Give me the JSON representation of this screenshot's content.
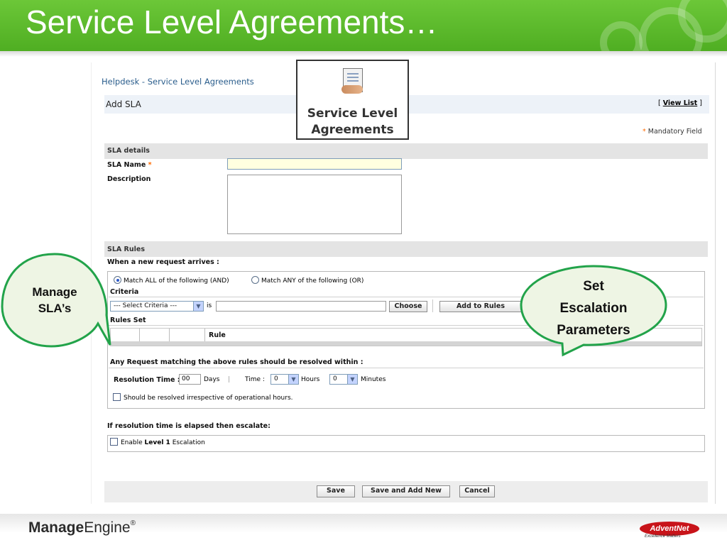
{
  "slide": {
    "title": "Service Level Agreements…",
    "brand_bold": "Manage",
    "brand_light": "Engine",
    "brand_reg": "®",
    "partner_logo": "AdventNet",
    "partner_tagline": "Excellence Matters"
  },
  "badge": {
    "line1": "Service Level",
    "line2": "Agreements",
    "icon": "handshake-document-icon"
  },
  "callouts": {
    "left": [
      "Manage",
      "SLA’s"
    ],
    "right": [
      "Set",
      "Escalation",
      "Parameters"
    ]
  },
  "app": {
    "breadcrumb": "Helpdesk - Service Level Agreements",
    "form_title": "Add SLA",
    "view_list": "View List",
    "mandatory_field": "Mandatory Field",
    "sla_details": {
      "section_title": "SLA details",
      "name_label": "SLA Name",
      "name_value": "",
      "description_label": "Description",
      "description_value": ""
    },
    "sla_rules": {
      "section_title": "SLA Rules",
      "when_label": "When a new request arrives :",
      "match_all": "Match ALL of the following (AND)",
      "match_any": "Match ANY of the following (OR)",
      "match_selected": "all",
      "criteria_label": "Criteria",
      "criteria_select": "--- Select Criteria ---",
      "is_label": "is",
      "criteria_value": "",
      "choose_button": "Choose",
      "add_to_rules_button": "Add to Rules",
      "rules_set_label": "Rules Set",
      "rule_column": "Rule",
      "resolve_within": "Any Request matching the above rules should be resolved within :",
      "resolution_time_label": "Resolution Time :",
      "days_value": "00",
      "days_label": "Days",
      "separator": "|",
      "time_label": "Time :",
      "hours_value": "0",
      "hours_label": "Hours",
      "minutes_value": "0",
      "minutes_label": "Minutes",
      "operational_hours": "Should be resolved irrespective of operational hours."
    },
    "escalation": {
      "label": "If resolution time is elapsed then escalate:",
      "enable_prefix": "Enable ",
      "enable_level": "Level 1",
      "enable_suffix": " Escalation"
    },
    "buttons": {
      "save": "Save",
      "save_and_add_new": "Save and Add New",
      "cancel": "Cancel"
    },
    "colors": {
      "header_green": "#5bb82b",
      "callout_border": "#22a34a",
      "input_highlight": "#ffffe0",
      "mandatory_star": "#ff6a00",
      "link_blue": "#2a5d8c"
    }
  }
}
